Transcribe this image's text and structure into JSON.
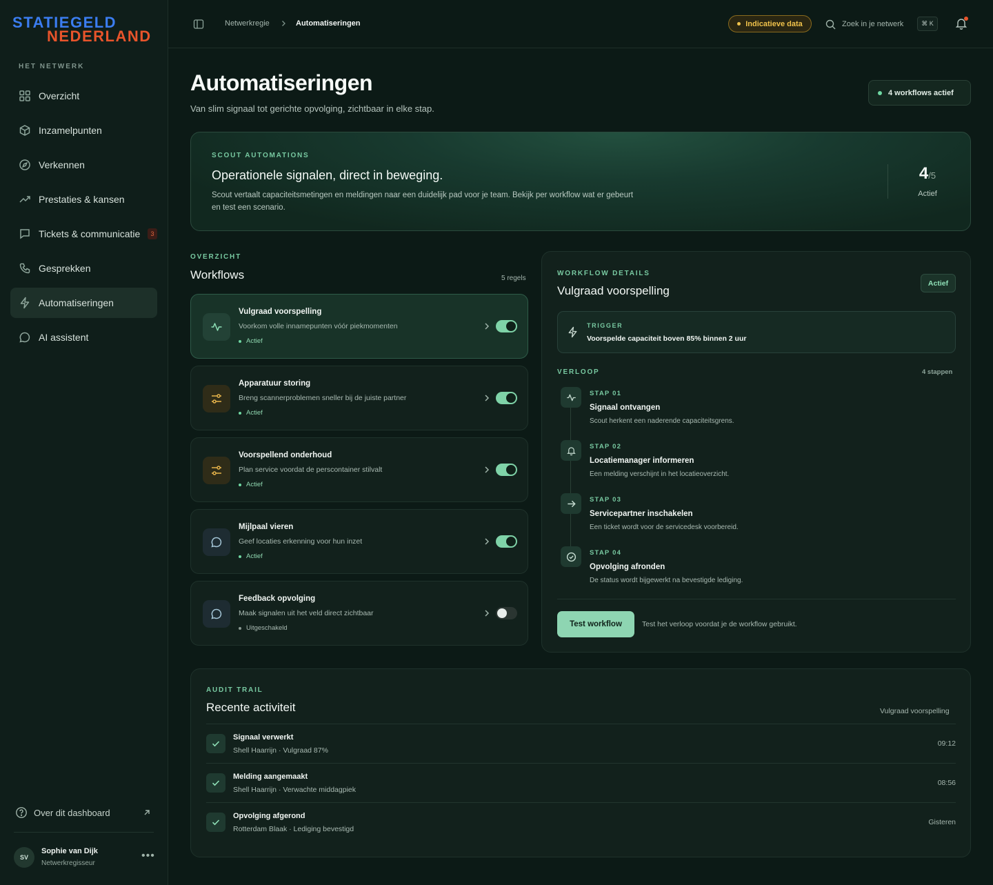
{
  "brand": {
    "line1": "STATIEGELD",
    "line2": "NEDERLAND",
    "color1": "#3b7df0",
    "color2": "#e8542b"
  },
  "sidebar": {
    "heading": "HET NETWERK",
    "items": [
      {
        "label": "Overzicht",
        "icon": "grid-icon"
      },
      {
        "label": "Inzamelpunten",
        "icon": "box-icon"
      },
      {
        "label": "Verkennen",
        "icon": "compass-icon"
      },
      {
        "label": "Prestaties & kansen",
        "icon": "trend-icon"
      },
      {
        "label": "Tickets & communicatie",
        "icon": "chat-icon",
        "badge": "3"
      },
      {
        "label": "Gesprekken",
        "icon": "phone-icon"
      },
      {
        "label": "Automatiseringen",
        "icon": "bolt-icon",
        "active": true
      },
      {
        "label": "AI assistent",
        "icon": "chat-bubble-icon"
      }
    ],
    "about": "Over dit dashboard",
    "user": {
      "initials": "SV",
      "name": "Sophie van Dijk",
      "role": "Netwerkregisseur"
    }
  },
  "topbar": {
    "breadcrumb": [
      "Netwerkregie",
      "Automatiseringen"
    ],
    "data_pill": "Indicatieve data",
    "search_placeholder": "Zoek in je netwerk",
    "shortcut": "⌘ K"
  },
  "header": {
    "title": "Automatiseringen",
    "subtitle": "Van slim signaal tot gerichte opvolging, zichtbaar in elke stap.",
    "active_pill": "4 workflows actief"
  },
  "hero": {
    "eyebrow": "SCOUT AUTOMATIONS",
    "title": "Operationele signalen, direct in beweging.",
    "text": "Scout vertaalt capaciteitsmetingen en meldingen naar een duidelijk pad voor je team. Bekijk per workflow wat er gebeurt en test een scenario.",
    "active_count": "4",
    "total": "/5",
    "label": "Actief"
  },
  "workflows": {
    "eyebrow": "OVERZICHT",
    "title": "Workflows",
    "count": "5 regels",
    "items": [
      {
        "name": "Vulgraad voorspelling",
        "desc": "Voorkom volle innamepunten vóór piekmomenten",
        "status": "Actief",
        "enabled": true,
        "icon": "pulse-icon"
      },
      {
        "name": "Apparatuur storing",
        "desc": "Breng scannerproblemen sneller bij de juiste partner",
        "status": "Actief",
        "enabled": true,
        "icon": "sliders-icon"
      },
      {
        "name": "Voorspellend onderhoud",
        "desc": "Plan service voordat de perscontainer stilvalt",
        "status": "Actief",
        "enabled": true,
        "icon": "sliders-icon"
      },
      {
        "name": "Mijlpaal vieren",
        "desc": "Geef locaties erkenning voor hun inzet",
        "status": "Actief",
        "enabled": true,
        "icon": "chat-bubble-icon"
      },
      {
        "name": "Feedback opvolging",
        "desc": "Maak signalen uit het veld direct zichtbaar",
        "status": "Uitgeschakeld",
        "enabled": false,
        "icon": "chat-bubble-icon"
      }
    ]
  },
  "details": {
    "eyebrow": "WORKFLOW DETAILS",
    "title": "Vulgraad voorspelling",
    "badge": "Actief",
    "trigger_label": "TRIGGER",
    "trigger_text": "Voorspelde capaciteit boven 85% binnen 2 uur",
    "verloop_label": "VERLOOP",
    "verloop_count": "4 stappen",
    "steps": [
      {
        "num": "STAP 01",
        "title": "Signaal ontvangen",
        "desc": "Scout herkent een naderende capaciteitsgrens.",
        "icon": "pulse-icon"
      },
      {
        "num": "STAP 02",
        "title": "Locatiemanager informeren",
        "desc": "Een melding verschijnt in het locatieoverzicht.",
        "icon": "bell-icon"
      },
      {
        "num": "STAP 03",
        "title": "Servicepartner inschakelen",
        "desc": "Een ticket wordt voor de servicedesk voorbereid.",
        "icon": "arrow-right-icon"
      },
      {
        "num": "STAP 04",
        "title": "Opvolging afronden",
        "desc": "De status wordt bijgewerkt na bevestigde lediging.",
        "icon": "check-circle-icon"
      }
    ],
    "test_button": "Test workflow",
    "test_text": "Test het verloop voordat je de workflow gebruikt."
  },
  "audit": {
    "eyebrow": "AUDIT TRAIL",
    "title": "Recente activiteit",
    "filter": "Vulgraad voorspelling",
    "rows": [
      {
        "name": "Signaal verwerkt",
        "meta": "Shell Haarrijn · Vulgraad 87%",
        "time": "09:12"
      },
      {
        "name": "Melding aangemaakt",
        "meta": "Shell Haarrijn · Verwachte middagpiek",
        "time": "08:56"
      },
      {
        "name": "Opvolging afgerond",
        "meta": "Rotterdam Blaak · Lediging bevestigd",
        "time": "Gisteren"
      }
    ]
  }
}
